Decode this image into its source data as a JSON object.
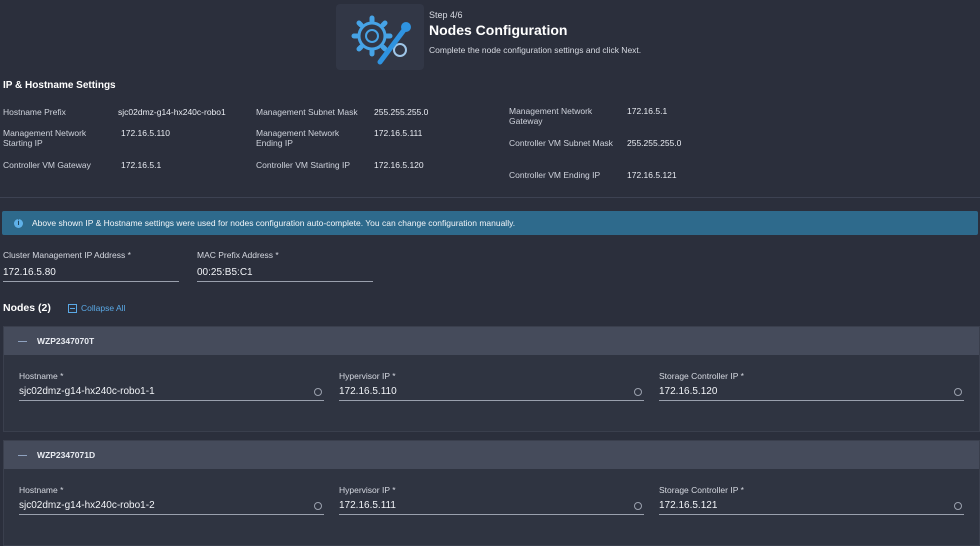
{
  "header": {
    "step": "Step 4/6",
    "title": "Nodes Configuration",
    "subtitle": "Complete the node configuration settings and click Next."
  },
  "ip_settings": {
    "title": "IP & Hostname Settings",
    "items": [
      {
        "label": "Hostname Prefix",
        "value": "sjc02dmz-g14-hx240c-robo1"
      },
      {
        "label": "Management Network Starting IP",
        "value": "172.16.5.110"
      },
      {
        "label": "Controller VM Gateway",
        "value": "172.16.5.1"
      },
      {
        "label": "Management Subnet Mask",
        "value": "255.255.255.0"
      },
      {
        "label": "Management Network Ending IP",
        "value": "172.16.5.111"
      },
      {
        "label": "Controller VM Starting IP",
        "value": "172.16.5.120"
      },
      {
        "label": "Management Network Gateway",
        "value": "172.16.5.1"
      },
      {
        "label": "Controller VM Subnet Mask",
        "value": "255.255.255.0"
      },
      {
        "label": "Controller VM Ending IP",
        "value": "172.16.5.121"
      }
    ]
  },
  "banner": {
    "text": "Above shown IP & Hostname settings were used for nodes configuration auto-complete. You can change configuration manually."
  },
  "cluster": {
    "mgmt_ip_label": "Cluster Management IP Address *",
    "mgmt_ip_value": "172.16.5.80",
    "mac_label": "MAC Prefix Address *",
    "mac_value": "00:25:B5:C1"
  },
  "nodes": {
    "title": "Nodes (2)",
    "collapse_label": "Collapse All",
    "hostname_label": "Hostname *",
    "hypervisor_label": "Hypervisor IP *",
    "storage_label": "Storage Controller IP *",
    "list": [
      {
        "serial": "WZP2347070T",
        "hostname": "sjc02dmz-g14-hx240c-robo1-1",
        "hypervisor_ip": "172.16.5.110",
        "storage_ip": "172.16.5.120"
      },
      {
        "serial": "WZP2347071D",
        "hostname": "sjc02dmz-g14-hx240c-robo1-2",
        "hypervisor_ip": "172.16.5.111",
        "storage_ip": "172.16.5.121"
      }
    ]
  },
  "colors": {
    "background": "#2b2f3c",
    "banner": "#2e6a8c",
    "accent": "#5aa9e6",
    "node_header": "#454b5b"
  },
  "icons": {
    "hero": "gear-wrench-icon",
    "info": "info-icon",
    "collapse": "collapse-icon",
    "field_hint": "info-circle-icon"
  }
}
